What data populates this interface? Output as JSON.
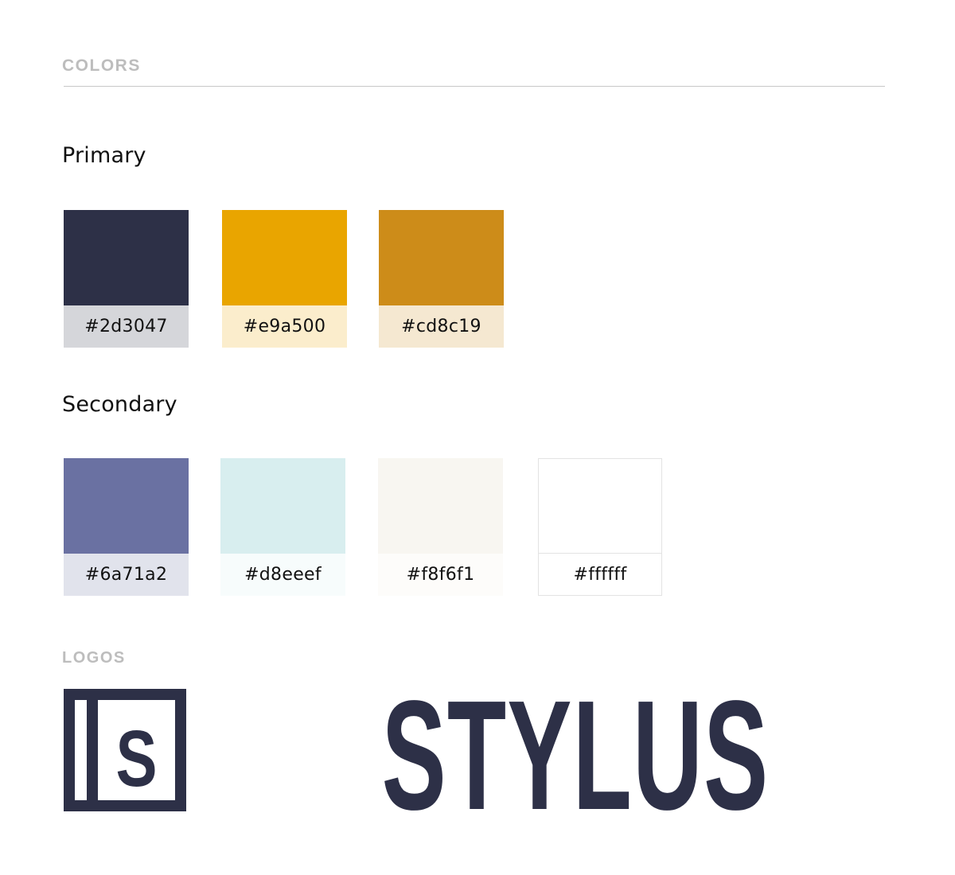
{
  "colors_section": {
    "label": "COLORS"
  },
  "primary": {
    "title": "Primary",
    "swatches": [
      {
        "hex": "#2d3047",
        "swatch_color": "#2d3047",
        "label_bg": "#d5d6da"
      },
      {
        "hex": "#e9a500",
        "swatch_color": "#e9a500",
        "label_bg": "#fbedcc"
      },
      {
        "hex": "#cd8c19",
        "swatch_color": "#cd8c19",
        "label_bg": "#f5e8d1"
      }
    ]
  },
  "secondary": {
    "title": "Secondary",
    "swatches": [
      {
        "hex": "#6a71a2",
        "swatch_color": "#6a71a2",
        "label_bg": "#e1e3ec"
      },
      {
        "hex": "#d8eeef",
        "swatch_color": "#d8eeef",
        "label_bg": "#f7fcfc"
      },
      {
        "hex": "#f8f6f1",
        "swatch_color": "#f8f6f1",
        "label_bg": "#fdfcfa"
      },
      {
        "hex": "#ffffff",
        "swatch_color": "#ffffff",
        "label_bg": "#ffffff"
      }
    ]
  },
  "logos_section": {
    "label": "LOGOS",
    "mark_text": "S",
    "wordmark_text": "STYLUS",
    "logo_color": "#2d3047"
  }
}
